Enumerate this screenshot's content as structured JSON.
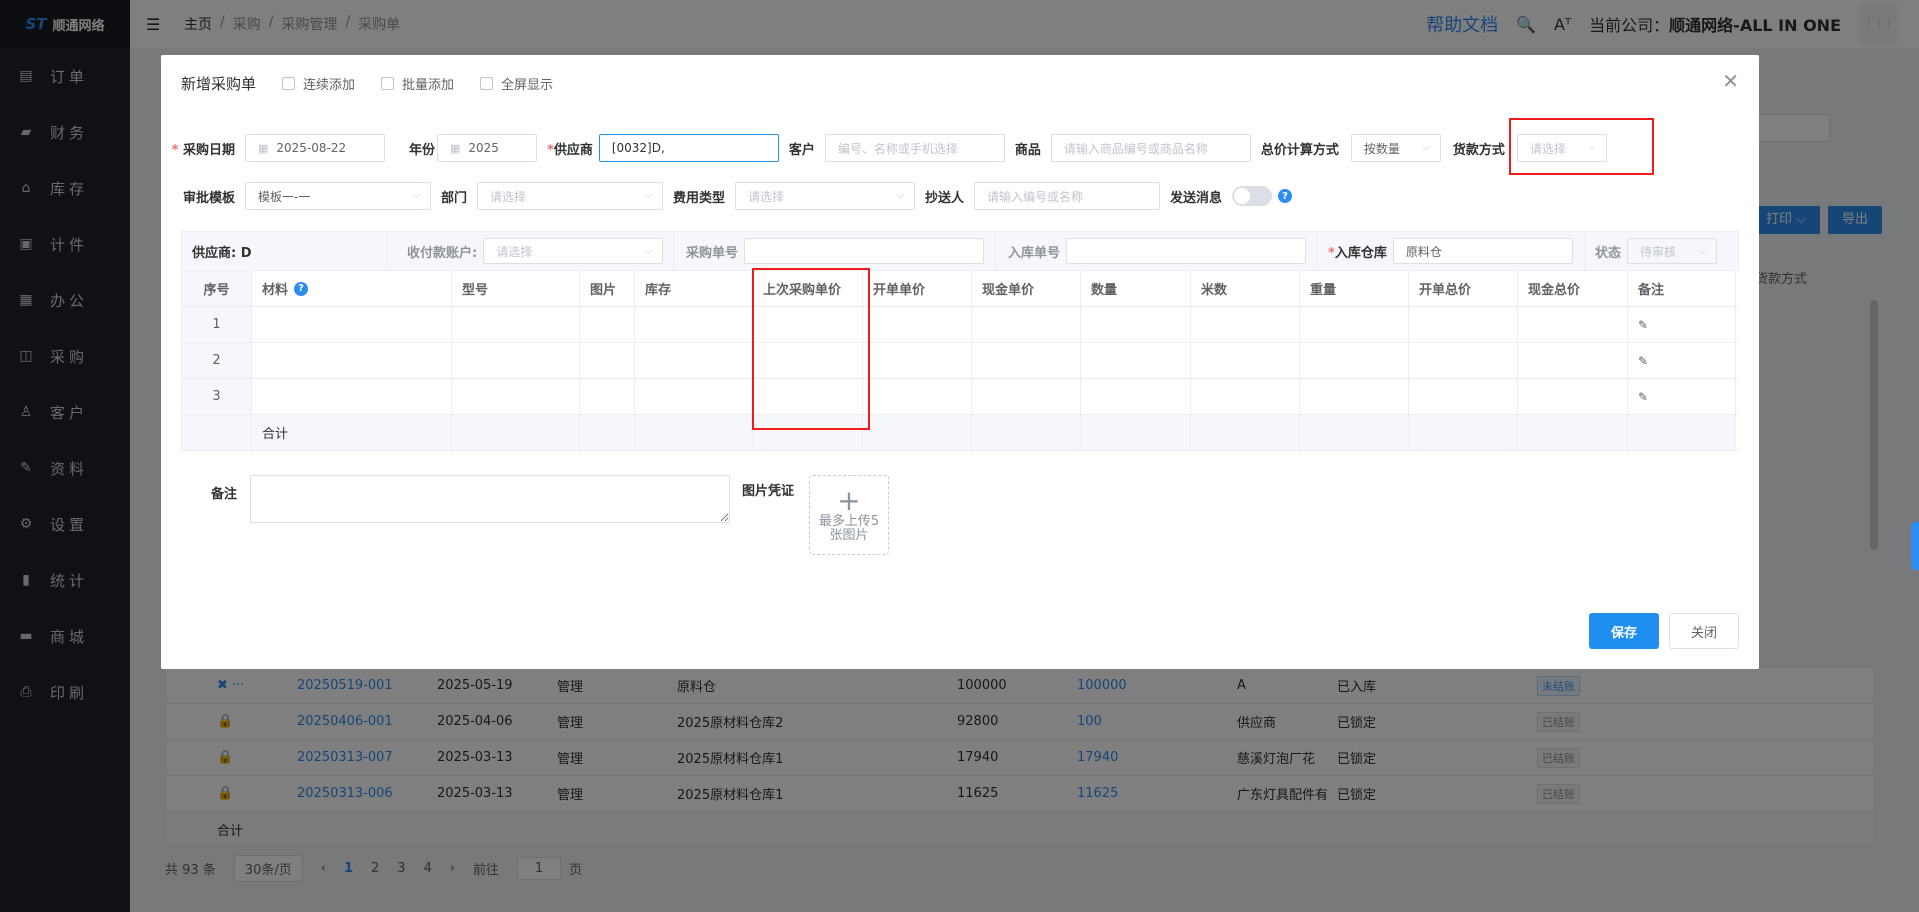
{
  "app": {
    "logo_text": "顺通网络"
  },
  "sidebar": {
    "items": [
      {
        "label": "订单",
        "icon": "file-icon",
        "glyph": "▤"
      },
      {
        "label": "财务",
        "icon": "wallet-icon",
        "glyph": "▰"
      },
      {
        "label": "库存",
        "icon": "home-icon",
        "glyph": "⌂"
      },
      {
        "label": "计件",
        "icon": "clipboard-icon",
        "glyph": "▣"
      },
      {
        "label": "办公",
        "icon": "calendar-icon",
        "glyph": "▦"
      },
      {
        "label": "采购",
        "icon": "bag-icon",
        "glyph": "◫"
      },
      {
        "label": "客户",
        "icon": "user-icon",
        "glyph": "♙"
      },
      {
        "label": "资料",
        "icon": "pen-icon",
        "glyph": "✎"
      },
      {
        "label": "设置",
        "icon": "gear-icon",
        "glyph": "⚙"
      },
      {
        "label": "统计",
        "icon": "bar-chart-icon",
        "glyph": "▮"
      },
      {
        "label": "商城",
        "icon": "store-icon",
        "glyph": "▬"
      },
      {
        "label": "印刷",
        "icon": "printer-icon",
        "glyph": "⎙"
      }
    ]
  },
  "header": {
    "breadcrumb": [
      "主页",
      "采购",
      "采购管理",
      "采购单"
    ],
    "help": "帮助文档",
    "company_prefix": "当前公司：",
    "company_name": "顺通网络-ALL IN ONE"
  },
  "background": {
    "print_btn": "打印 ⌵",
    "export_btn": "导出",
    "col_payment": "货款方式",
    "rows": [
      {
        "no": "20250519-001",
        "date": "2025-05-19",
        "user": "管理",
        "warehouse": "原料仓",
        "amount": "100000",
        "amount2": "100000",
        "party": "A",
        "status": "已入库",
        "tag": "未结账",
        "tag_type": "unsettled",
        "action": "✖ ···"
      },
      {
        "no": "20250406-001",
        "date": "2025-04-06",
        "user": "管理",
        "warehouse": "2025原材料仓库2",
        "amount": "92800",
        "amount2": "100",
        "party": "供应商",
        "status": "已锁定",
        "tag": "已结账",
        "tag_type": "lock",
        "action": "🔒"
      },
      {
        "no": "20250313-007",
        "date": "2025-03-13",
        "user": "管理",
        "warehouse": "2025原材料仓库1",
        "amount": "17940",
        "amount2": "17940",
        "party": "慈溪灯泡厂花",
        "status": "已锁定",
        "tag": "已结账",
        "tag_type": "lock",
        "action": "🔒"
      },
      {
        "no": "20250313-006",
        "date": "2025-03-13",
        "user": "管理",
        "warehouse": "2025原材料仓库1",
        "amount": "11625",
        "amount2": "11625",
        "party": "广东灯具配件有限公司",
        "status": "已锁定",
        "tag": "已结账",
        "tag_type": "lock",
        "action": "🔒"
      }
    ],
    "sum_label": "合计",
    "pager": {
      "total": "共 93 条",
      "page_size": "30条/页",
      "pages": [
        "1",
        "2",
        "3",
        "4"
      ],
      "goto": "前往",
      "goto_value": "1",
      "page_unit": "页"
    }
  },
  "dialog": {
    "title": "新增采购单",
    "options": [
      "连续添加",
      "批量添加",
      "全屏显示"
    ],
    "form": {
      "date_label": "采购日期",
      "date_value": "2025-08-22",
      "year_label": "年份",
      "year_value": "2025",
      "supplier_label": "供应商",
      "supplier_value": "[0032]D,",
      "customer_label": "客户",
      "customer_ph": "编号、名称或手机选择",
      "goods_label": "商品",
      "goods_ph": "请输入商品编号或商品名称",
      "calc_label": "总价计算方式",
      "calc_value": "按数量",
      "pay_label": "货款方式",
      "pay_ph": "请选择",
      "approval_label": "审批模板",
      "approval_value": "模板一-一",
      "dept_label": "部门",
      "dept_ph": "请选择",
      "fee_label": "费用类型",
      "fee_ph": "请选择",
      "cc_label": "抄送人",
      "cc_ph": "请输入编号或名称",
      "notify_label": "发送消息"
    },
    "info": {
      "supplier": "供应商: D",
      "account_label": "收付款账户:",
      "account_ph": "请选择",
      "po_label": "采购单号",
      "inbound_label": "入库单号",
      "warehouse_label": "入库仓库",
      "warehouse_value": "原料仓",
      "status_label": "状态",
      "status_value": "待审核"
    },
    "table": {
      "headers": [
        "序号",
        "材料",
        "型号",
        "图片",
        "库存",
        "上次采购单价",
        "开单单价",
        "现金单价",
        "数量",
        "米数",
        "重量",
        "开单总价",
        "现金总价",
        "备注"
      ],
      "rows": [
        "1",
        "2",
        "3"
      ],
      "sum_label": "合计"
    },
    "notes_label": "备注",
    "image_label": "图片凭证",
    "upload_text": "最多上传5张图片",
    "save": "保存",
    "close": "关闭"
  }
}
